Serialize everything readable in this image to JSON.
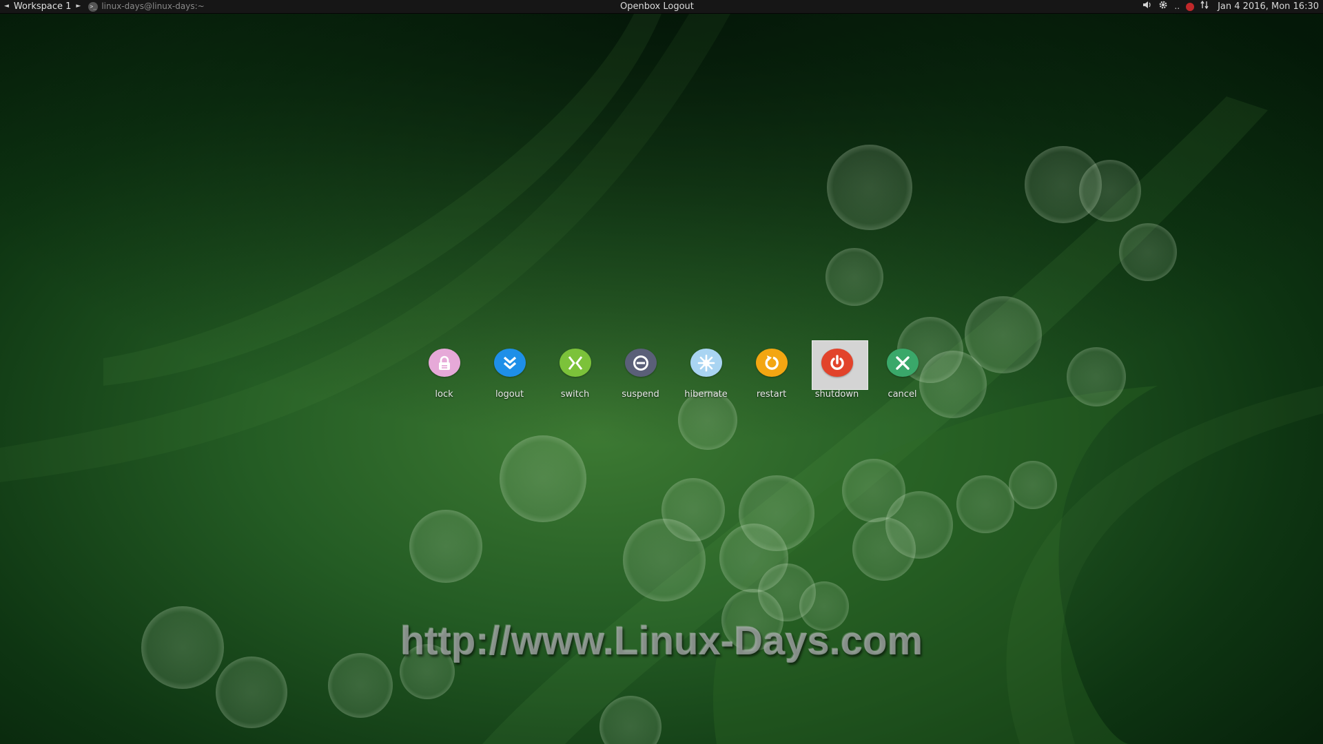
{
  "panel": {
    "workspace": "Workspace 1",
    "task_title": "linux-days@linux-days:~",
    "window_title": "Openbox Logout",
    "tray_separator": "..",
    "clock": "Jan  4 2016, Mon 16:30",
    "icons": [
      "volume-icon",
      "settings-gear-icon",
      "record-icon",
      "network-icon"
    ]
  },
  "logout": {
    "buttons": [
      {
        "label": "lock",
        "icon": "lock-icon",
        "color": "#e6a9d8"
      },
      {
        "label": "logout",
        "icon": "logout-chevrons-icon",
        "color": "#1e8fe8"
      },
      {
        "label": "switch",
        "icon": "switch-user-icon",
        "color": "#7cc23a"
      },
      {
        "label": "suspend",
        "icon": "suspend-icon",
        "color": "#5a5f78"
      },
      {
        "label": "hibernate",
        "icon": "hibernate-snowflake-icon",
        "color": "#a9d4f2"
      },
      {
        "label": "restart",
        "icon": "restart-icon",
        "color": "#f3a612"
      },
      {
        "label": "shutdown",
        "icon": "power-icon",
        "color": "#e2432b"
      },
      {
        "label": "cancel",
        "icon": "cancel-icon",
        "color": "#3aa86a"
      }
    ],
    "selected": "shutdown"
  },
  "watermark": "http://www.Linux-Days.com"
}
